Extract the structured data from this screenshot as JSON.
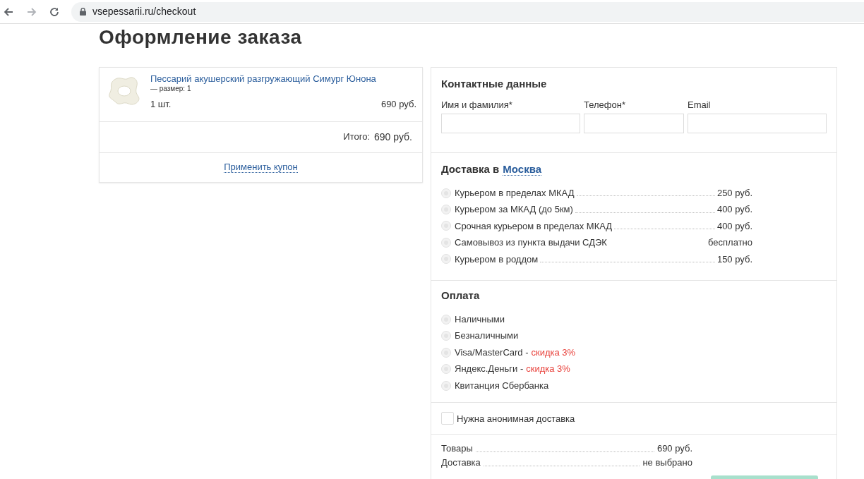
{
  "browser": {
    "url": "vsepessarii.ru/checkout"
  },
  "page_title": "Оформление заказа",
  "cart": {
    "items": [
      {
        "name": "Пессарий акушерский разгружающий Симург Юнона",
        "option": "— размер: 1",
        "quantity": "1 шт.",
        "price": "690 руб."
      }
    ],
    "total_label": "Итого:",
    "total": "690 руб.",
    "coupon_link": "Применить купон"
  },
  "contact": {
    "heading": "Контактные данные",
    "fields": [
      {
        "label": "Имя и фамилия*"
      },
      {
        "label": "Телефон*"
      },
      {
        "label": "Email"
      }
    ]
  },
  "delivery": {
    "heading": "Доставка в",
    "city": "Москва",
    "options": [
      {
        "label": "Курьером в пределах МКАД",
        "price": "250 руб.",
        "selected": false,
        "leader": true
      },
      {
        "label": "Курьером за МКАД (до 5км)",
        "price": "400 руб.",
        "selected": false,
        "leader": true
      },
      {
        "label": "Срочная курьером в пределах МКАД",
        "price": "400 руб.",
        "selected": false,
        "leader": true
      },
      {
        "label": "Самовывоз из пункта выдачи СДЭК",
        "price": "бесплатно",
        "selected": false,
        "leader": false
      },
      {
        "label": "Курьером в роддом",
        "price": "150 руб.",
        "selected": false,
        "leader": true
      }
    ]
  },
  "payment": {
    "heading": "Оплата",
    "options": [
      {
        "label": "Наличными",
        "selected": false
      },
      {
        "label": "Безналичными",
        "selected": false
      },
      {
        "label": "Visa/MasterCard -",
        "discount": "скидка 3%",
        "selected": false
      },
      {
        "label": "Яндекс.Деньги -",
        "discount": "скидка 3%",
        "selected": false
      },
      {
        "label": "Квитанция Сбербанка",
        "selected": false
      }
    ]
  },
  "anonymous": {
    "label": "Нужна анонимная доставка",
    "checked": false
  },
  "summary": [
    {
      "label": "Товары",
      "value": "690 руб."
    },
    {
      "label": "Доставка",
      "value": "не выбрано"
    }
  ]
}
